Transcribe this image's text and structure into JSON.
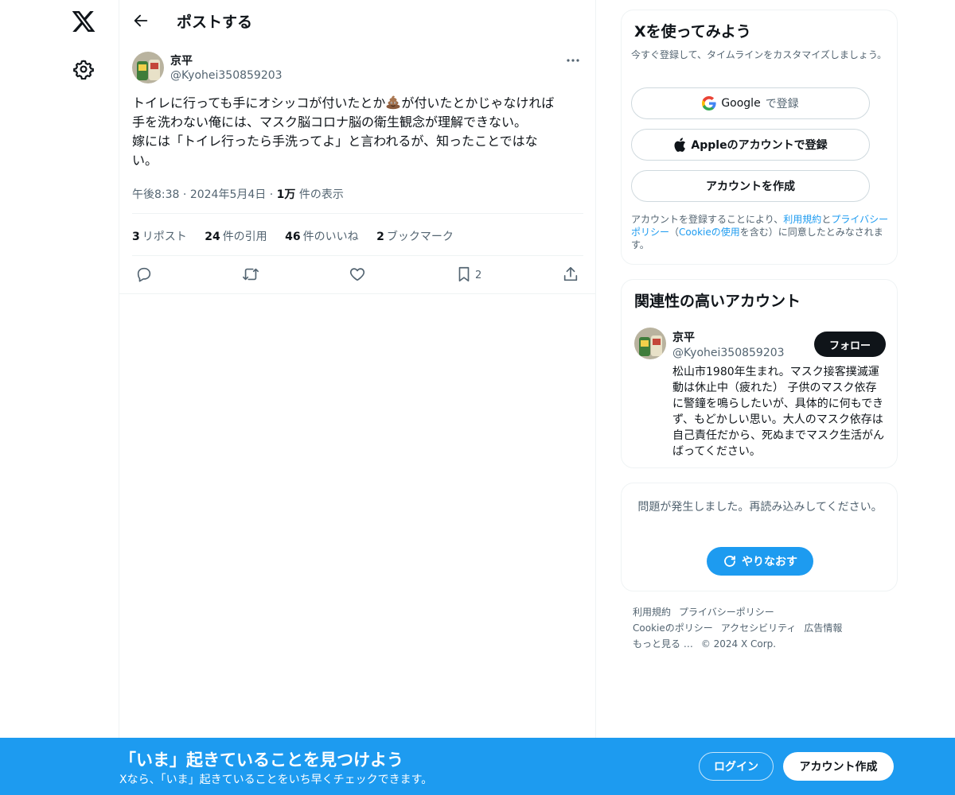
{
  "colors": {
    "accent": "#1d9bf0",
    "text": "#0f1419",
    "secondary": "#536471",
    "border": "#eff3f4"
  },
  "nav": {
    "logo_icon": "x-logo-icon",
    "settings_icon": "gear-icon"
  },
  "header": {
    "title": "ポストする"
  },
  "post": {
    "author_name": "京平",
    "author_handle": "@Kyohei350859203",
    "text_lines": [
      {
        "before": "トイレに行っても手にオシッコが付いたとか",
        "after": "が付いたとかじゃなければ"
      },
      "手を洗わない俺には、マスク脳コロナ脳の衛生観念が理解できない。",
      "嫁には「トイレ行ったら手洗ってよ」と言われるが、知ったことではな",
      "い。"
    ],
    "time": "午後8:38",
    "date": "2024年5月4日",
    "views_count": "1万",
    "views_label": "件の表示",
    "stats": [
      {
        "count": "3",
        "label": "リポスト"
      },
      {
        "count": "24",
        "label": "件の引用"
      },
      {
        "count": "46",
        "label": "件のいいね"
      },
      {
        "count": "2",
        "label": "ブックマーク"
      }
    ],
    "bookmark_count": "2"
  },
  "signup_card": {
    "title": "Xを使ってみよう",
    "subtitle": "今すぐ登録して、タイムラインをカスタマイズしましょう。",
    "google_brand": "Google",
    "google_suffix": "で登録",
    "apple_label": "Appleのアカウントで登録",
    "create_label": "アカウントを作成",
    "legal_1": "アカウントを登録することにより、",
    "legal_terms": "利用規約",
    "legal_and": "と",
    "legal_privacy": "プライバシーポリシー",
    "legal_open": "（",
    "legal_cookie": "Cookieの使用",
    "legal_2": "を含む）に同意したとみなされます。"
  },
  "related": {
    "title": "関連性の高いアカウント",
    "name": "京平",
    "handle": "@Kyohei350859203",
    "follow_label": "フォロー",
    "bio": "松山市1980年生まれ。マスク接客撲滅運動は休止中（疲れた） 子供のマスク依存に警鐘を鳴らしたいが、具体的に何もできず、もどかしい思い。大人のマスク依存は自己責任だから、死ぬまでマスク生活がんばってください。"
  },
  "error_card": {
    "message": "問題が発生しました。再読み込みしてください。",
    "retry_label": "やりなおす"
  },
  "footer": {
    "links": [
      "利用規約",
      "プライバシーポリシー",
      "Cookieのポリシー",
      "アクセシビリティ",
      "広告情報",
      "もっと見る …",
      "© 2024 X Corp."
    ]
  },
  "banner": {
    "title": "「いま」起きていることを見つけよう",
    "subtitle": "Xなら、「いま」起きていることをいち早くチェックできます。",
    "login_label": "ログイン",
    "signup_label": "アカウント作成"
  }
}
